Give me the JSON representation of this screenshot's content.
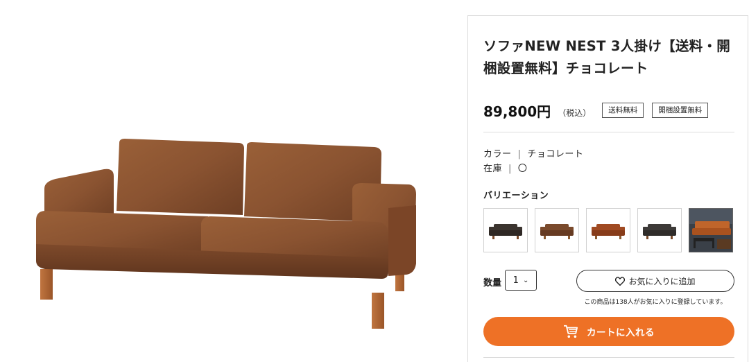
{
  "product": {
    "title": "ソファNEW NEST 3人掛け【送料・開梱設置無料】チョコレート",
    "price": "89,800円",
    "tax_note": "（税込）",
    "tags": [
      "送料無料",
      "開梱設置無料"
    ],
    "color_label": "カラー",
    "color_value": "チョコレート",
    "stock_label": "在庫",
    "stock_value": "〇",
    "variation_label": "バリエーション",
    "variations": [
      {
        "color": "#3b342f",
        "leg": "#7a4a2a"
      },
      {
        "color": "#7a4a2c",
        "leg": "#8a5a30"
      },
      {
        "color": "#a04a22",
        "leg": "#8a5a30"
      },
      {
        "color": "#3d3a38",
        "leg": "#7a4a2a"
      },
      {
        "color": "#c0652b",
        "leg": "#2a2a2a"
      }
    ],
    "qty_label": "数量",
    "qty_value": "1",
    "favorite_button": "お気に入りに追加",
    "favorite_note": "この商品は138人がお気に入りに登録しています。",
    "cart_button": "カートに入れる"
  },
  "colors": {
    "accent": "#ee7126",
    "sofa_main": "#8a5331",
    "sofa_shadow": "#6e3f24",
    "sofa_leg": "#b8693a"
  }
}
